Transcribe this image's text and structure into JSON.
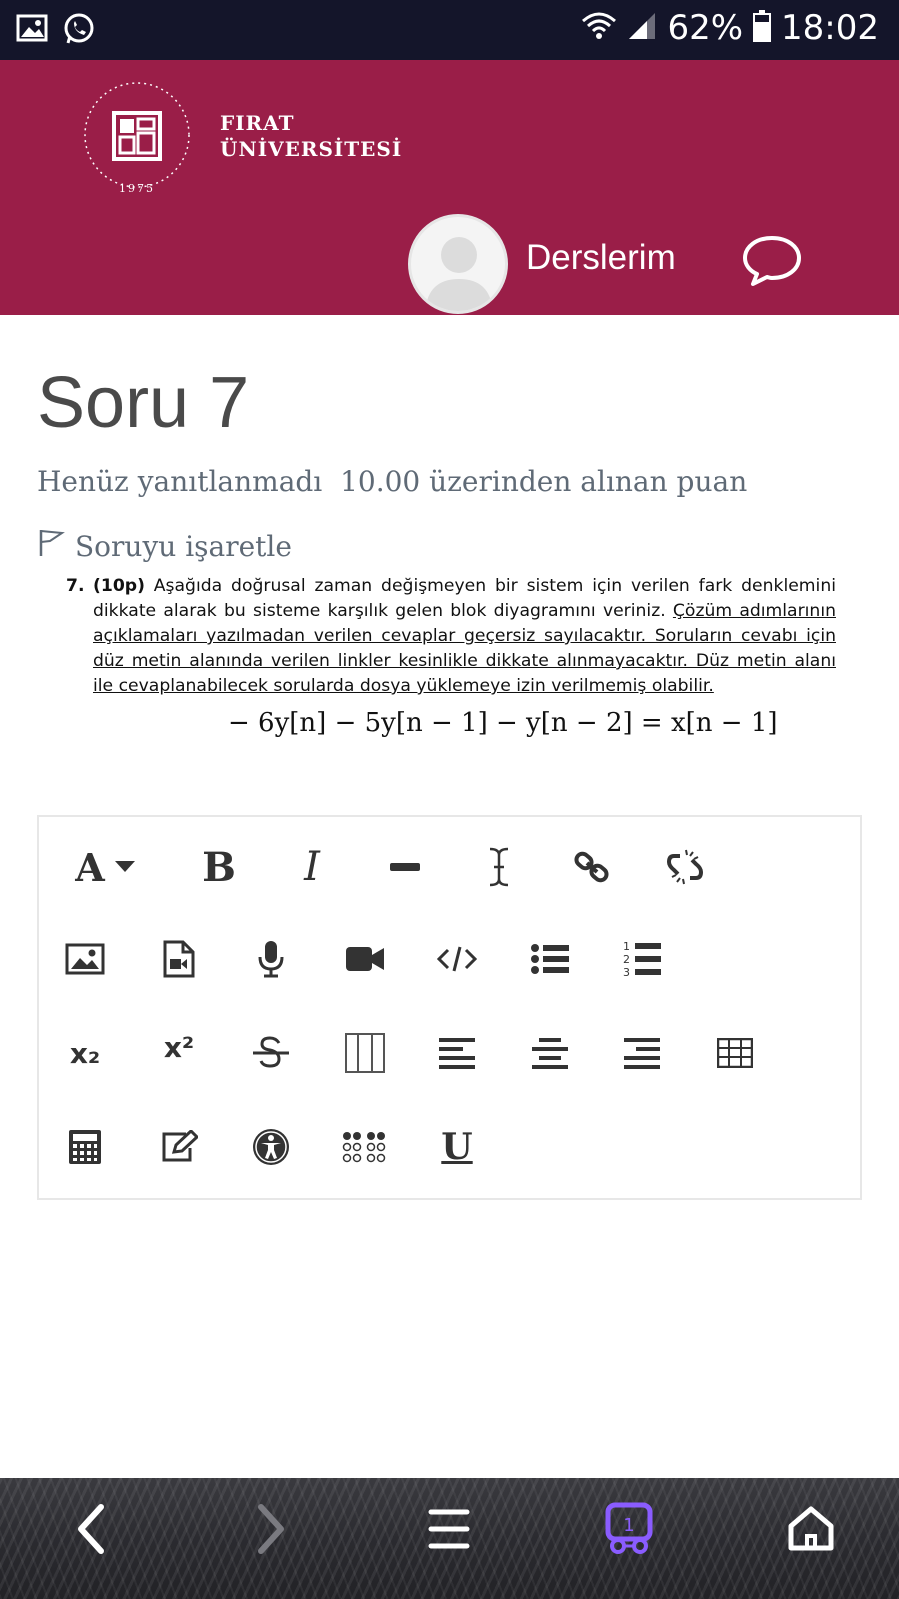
{
  "status_bar": {
    "battery": "62%",
    "time": "18:02"
  },
  "header": {
    "logo": {
      "seal_ring_text": "FIRAT ÜNİVERSİTESİ",
      "seal_year": "1975",
      "name_line1": "FIRAT",
      "name_line2": "ÜNİVERSİTESİ"
    },
    "courses_label": "Derslerim"
  },
  "question": {
    "title": "Soru 7",
    "status": "Henüz yanıtlanmadı",
    "grade": "10.00 üzerinden alınan puan",
    "flag_label": "Soruyu işaretle",
    "number": "7.",
    "points": "(10p)",
    "text_plain": " Aşağıda doğrusal zaman değişmeyen bir sistem için verilen fark denklemini dikkate alarak bu sisteme karşılık gelen blok diyagramını veriniz. ",
    "text_underlined": "Çözüm adımlarının açıklamaları yazılmadan verilen cevaplar geçersiz sayılacaktır. Soruların cevabı için düz metin alanında verilen linkler kesinlikle dikkate alınmayacaktır. Düz metin alanı ile cevaplanabilecek sorularda dosya yüklemeye izin verilmemiş olabilir.",
    "equation": "− 6y[n] − 5y[n − 1] − y[n − 2] = x[n − 1]"
  },
  "editor_toolbar": {
    "font_label": "A",
    "bold_label": "B",
    "italic_label": "I",
    "underline_label": "U",
    "subscript_label": "x₂",
    "superscript_label": "x²"
  }
}
